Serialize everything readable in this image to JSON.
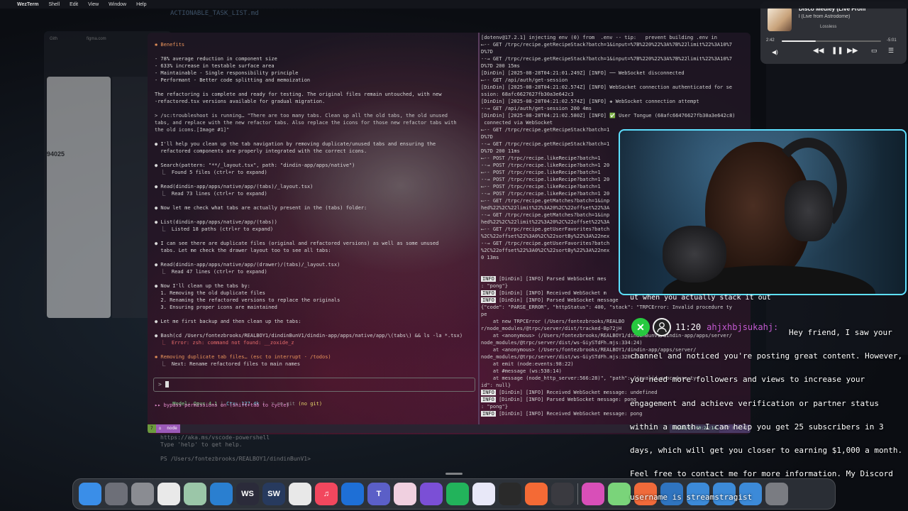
{
  "menubar": {
    "apple": "",
    "app_name": "WezTerm",
    "items": [
      "Shell",
      "Edit",
      "View",
      "Window",
      "Help"
    ]
  },
  "background": {
    "browser_tabs": [
      "Gith",
      "figma.com"
    ],
    "browser_number": "94025",
    "top_text": "ACTIONABLE_TASK_LIST.md",
    "powershell_lines": [
      "https://aka.ms/vscode-powershell",
      "Type 'help' to get help.",
      "",
      "PS /Users/fontezbrooks/REALBOY1/dindinBunV1>"
    ]
  },
  "terminal": {
    "left_lines": [
      {
        "t": "✱ Benefits",
        "c": "orange"
      },
      {
        "t": "",
        "c": ""
      },
      {
        "t": "- 78% average reduction in component size",
        "c": ""
      },
      {
        "t": "- 633% increase in testable surface area",
        "c": ""
      },
      {
        "t": "- Maintainable - Single responsibility principle",
        "c": ""
      },
      {
        "t": "- Performant - Better code splitting and memoization",
        "c": ""
      },
      {
        "t": "",
        "c": ""
      },
      {
        "t": "The refactoring is complete and ready for testing. The original files remain untouched, with new",
        "c": ""
      },
      {
        "t": "-refactored.tsx versions available for gradual migration.",
        "c": ""
      },
      {
        "t": "",
        "c": ""
      },
      {
        "t": "> /sc:troubleshoot is running… \"There are too many tabs. Clean up all the old tabs, the old unused",
        "c": "dim"
      },
      {
        "t": "tabs, and replace with the new refactor tabs. Also replace the icons for those new refactor tabs with",
        "c": "dim"
      },
      {
        "t": "the old icons.[Image #1]\"",
        "c": "dim"
      },
      {
        "t": "",
        "c": ""
      },
      {
        "t": "● I'll help you clean up the tab navigation by removing duplicate/unused tabs and ensuring the",
        "c": "w"
      },
      {
        "t": "  refactored components are properly integrated with the correct icons.",
        "c": ""
      },
      {
        "t": "",
        "c": ""
      },
      {
        "t": "● Search(pattern: \"**/_layout.tsx\", path: \"dindin-app/apps/native\")",
        "c": "g"
      },
      {
        "t": "  ⎿  Found 5 files (ctrl+r to expand)",
        "c": ""
      },
      {
        "t": "",
        "c": ""
      },
      {
        "t": "● Read(dindin-app/apps/native/app/(tabs)/_layout.tsx)",
        "c": "g"
      },
      {
        "t": "  ⎿  Read 73 lines (ctrl+r to expand)",
        "c": ""
      },
      {
        "t": "",
        "c": ""
      },
      {
        "t": "● Now let me check what tabs are actually present in the (tabs) folder:",
        "c": "w"
      },
      {
        "t": "",
        "c": ""
      },
      {
        "t": "● List(dindin-app/apps/native/app/(tabs))",
        "c": "g"
      },
      {
        "t": "  ⎿  Listed 18 paths (ctrl+r to expand)",
        "c": ""
      },
      {
        "t": "",
        "c": ""
      },
      {
        "t": "● I can see there are duplicate files (original and refactored versions) as well as some unused",
        "c": "w"
      },
      {
        "t": "  tabs. Let me check the drawer layout too to see all tabs:",
        "c": ""
      },
      {
        "t": "",
        "c": ""
      },
      {
        "t": "● Read(dindin-app/apps/native/app/(drawer)/(tabs)/_layout.tsx)",
        "c": "g"
      },
      {
        "t": "  ⎿  Read 47 lines (ctrl+r to expand)",
        "c": ""
      },
      {
        "t": "",
        "c": ""
      },
      {
        "t": "● Now I'll clean up the tabs by:",
        "c": "w"
      },
      {
        "t": "  1. Removing the old duplicate files",
        "c": ""
      },
      {
        "t": "  2. Renaming the refactored versions to replace the originals",
        "c": ""
      },
      {
        "t": "  3. Ensuring proper icons are maintained",
        "c": ""
      },
      {
        "t": "",
        "c": ""
      },
      {
        "t": "● Let me first backup and then clean up the tabs:",
        "c": "w"
      },
      {
        "t": "",
        "c": ""
      },
      {
        "t": "● Bash(cd /Users/fontezbrooks/REALBOY1/dindinBunV1/dindin-app/apps/native/app/\\(tabs\\) && ls -la *.tsx)",
        "c": "g"
      },
      {
        "t": "  ⎿  Error: zsh: command not found: __zoxide_z",
        "c": "red"
      },
      {
        "t": "",
        "c": ""
      },
      {
        "t": "✱ Removing duplicate tab files… (esc to interrupt · /todos)",
        "c": "orange"
      },
      {
        "t": "  ⎿  Next: Rename refactored files to main names",
        "c": ""
      }
    ],
    "prompt_symbol": ">",
    "model_line": {
      "model": "Model: Opus 4.1",
      "ctx": "Ctx: 127.4k",
      "git": "(no git)",
      "sep1": " | ",
      "sep2": " | ",
      "nogit_sym": " ⌥ no git "
    },
    "bypass_line": "▸▸ bypass permissions on (shift+tab to cycle)",
    "right_lines": [
      {
        "t": "[dotenv@17.2.1] injecting env (0) from  .env -- tip:   prevent building .env in",
        "c": ""
      },
      {
        "t": "⟵-- GET /trpc/recipe.getRecipeStack?batch=1&input=%7B%220%22%3A%7B%22limit%22%3A10%7",
        "c": ""
      },
      {
        "t": "D%7D",
        "c": ""
      },
      {
        "t": "--→ GET /trpc/recipe.getRecipeStack?batch=1&input=%7B%220%22%3A%7B%22limit%22%3A10%7",
        "c": ""
      },
      {
        "t": "D%7D 200 15ms",
        "c": ""
      },
      {
        "t": "[DinDin] [2025-08-28T04:21:01.249Z] [INFO] ── WebSocket disconnected",
        "c": ""
      },
      {
        "t": "⟵-- GET /api/auth/get-session",
        "c": ""
      },
      {
        "t": "[DinDin] [2025-08-28T04:21:02.574Z] [INFO] WebSocket connection authenticated for se",
        "c": ""
      },
      {
        "t": "ssion: 68afc6627627fb30a3e642c3",
        "c": ""
      },
      {
        "t": "[DinDin] [2025-08-28T04:21:02.574Z] [INFO] ✚ WebSocket connection attempt",
        "c": ""
      },
      {
        "t": "--→ GET /api/auth/get-session 200 4ms",
        "c": ""
      },
      {
        "t": "[DinDin] [2025-08-28T04:21:02.580Z] [INFO] ✅ User Tongue (68afc66476627fb30a3e642c8)",
        "c": ""
      },
      {
        "t": " connected via WebSocket",
        "c": ""
      },
      {
        "t": "⟵-- GET /trpc/recipe.getRecipeStack?batch=1",
        "c": ""
      },
      {
        "t": "D%7D",
        "c": ""
      },
      {
        "t": "--→ GET /trpc/recipe.getRecipeStack?batch=1",
        "c": ""
      },
      {
        "t": "D%7D 200 11ms",
        "c": ""
      },
      {
        "t": "⟵-- POST /trpc/recipe.likeRecipe?batch=1",
        "c": ""
      },
      {
        "t": "--→ POST /trpc/recipe.likeRecipe?batch=1 20",
        "c": ""
      },
      {
        "t": "⟵-- POST /trpc/recipe.likeRecipe?batch=1",
        "c": ""
      },
      {
        "t": "--→ POST /trpc/recipe.likeRecipe?batch=1 20",
        "c": ""
      },
      {
        "t": "⟵-- POST /trpc/recipe.likeRecipe?batch=1",
        "c": ""
      },
      {
        "t": "--→ POST /trpc/recipe.likeRecipe?batch=1 20",
        "c": ""
      },
      {
        "t": "⟵-- GET /trpc/recipe.getMatches?batch=1&inp",
        "c": ""
      },
      {
        "t": "hed%22%2C%22limit%22%3A20%2C%22offset%22%3A",
        "c": ""
      },
      {
        "t": "--→ GET /trpc/recipe.getMatches?batch=1&inp",
        "c": ""
      },
      {
        "t": "hed%22%2C%22limit%22%3A20%2C%22offset%22%3A",
        "c": ""
      },
      {
        "t": "⟵-- GET /trpc/recipe.getUserFavorites?batch",
        "c": ""
      },
      {
        "t": "%2C%22offset%22%3A0%2C%22sortBy%22%3A%22nex",
        "c": ""
      },
      {
        "t": "--→ GET /trpc/recipe.getUserFavorites?batch",
        "c": ""
      },
      {
        "t": "%2C%22offset%22%3A0%2C%22sortBy%22%3A%22nex",
        "c": ""
      },
      {
        "t": "0 13ms",
        "c": ""
      },
      {
        "t": "",
        "c": ""
      },
      {
        "t": "",
        "c": ""
      },
      {
        "t": "INFO [DinDin] [INFO] Parsed WebSocket mes",
        "c": "info"
      },
      {
        "t": ": \"pong\"}",
        "c": ""
      },
      {
        "t": "INFO [DinDin] [INFO] Received WebSocket m",
        "c": "info"
      },
      {
        "t": "INFO [DinDin] [INFO] Parsed WebSocket message",
        "c": "info"
      },
      {
        "t": "{\"code\": \"PARSE_ERROR\", \"httpStatus\": 400, \"stack\": \"TRPCError: Invalid procedure ty",
        "c": ""
      },
      {
        "t": "pe",
        "c": ""
      },
      {
        "t": "    at new TRPCError (/Users/fontezbrooks/REALBO",
        "c": ""
      },
      {
        "t": "r/node_modules/@trpc/server/dist/tracked-Bp72jH",
        "c": ""
      },
      {
        "t": "    at <anonymous> (/Users/fontezbrooks/REALBOY1/dindinBunV1/dindin-app/apps/server/",
        "c": ""
      },
      {
        "t": "node_modules/@trpc/server/dist/ws-GiySTdFh.mjs:334:24)",
        "c": ""
      },
      {
        "t": "    at <anonymous> (/Users/fontezbrooks/REALBOY1/dindin-app/apps/server/",
        "c": ""
      },
      {
        "t": "node_modules/@trpc/server/dist/ws-GiySTdFh.mjs:328:23)",
        "c": ""
      },
      {
        "t": "    at emit (node:events:98:22)",
        "c": ""
      },
      {
        "t": "    at #message (ws:538:14)",
        "c": ""
      },
      {
        "t": "    at message (node_http_server:566:28)\", \"path\": \"invalid-procedure-ty",
        "c": ""
      },
      {
        "t": "id\": null}",
        "c": ""
      },
      {
        "t": "INFO [DinDin] [INFO] Received WebSocket message: undefined",
        "c": "info"
      },
      {
        "t": "INFO [DinDin] [INFO] Parsed WebSocket message: pong",
        "c": "info"
      },
      {
        "t": ": \"pong\"}",
        "c": ""
      },
      {
        "t": "INFO [DinDin] [INFO] Received WebSocket message: pong",
        "c": "info"
      }
    ],
    "status": {
      "tab_num": "7",
      "tab_icon": "⌂",
      "tab_name": "node",
      "datetime": "08/28/25 00:24:14",
      "extra": "+77 F 4:47"
    }
  },
  "music": {
    "title": "Disco Medley (Live From",
    "subtitle": "l (Live from Astrodome)",
    "device": "Lossless",
    "elapsed": "2:42",
    "remaining": "-5:01",
    "progress": 0.34,
    "icons": [
      "speaker-icon",
      "rewind-icon",
      "pause-icon",
      "forward-icon",
      "lyrics-icon",
      "queue-icon"
    ]
  },
  "chat": {
    "header": "ut when you actually stack it out",
    "time": "11:20",
    "user": "ahjxhbjsukahj:",
    "message": "Hey friend, I saw your channel and noticed you're posting great content. However, you need more followers and views to increase your engagement and achieve verification or partner status within a month. I can help you get 25 subscribers in 3 days, which will get you closer to earning $1,000 a month. Feel free to contact me for more information. My Discord username is streamstragist"
  },
  "dock": {
    "apps": [
      {
        "name": "finder-icon",
        "label": "",
        "bg": "#3a8ee8"
      },
      {
        "name": "launchpad-icon",
        "label": "",
        "bg": "#6d6f78"
      },
      {
        "name": "system-settings-icon",
        "label": "",
        "bg": "#8a8c92"
      },
      {
        "name": "chrome-icon",
        "label": "",
        "bg": "#e9e9e9"
      },
      {
        "name": "notes-app-icon",
        "label": "",
        "bg": "#9bc6a8"
      },
      {
        "name": "vscode-icon",
        "label": "",
        "bg": "#2a7fd0"
      },
      {
        "name": "wezterm-icon",
        "label": "WS",
        "bg": "#2b2b3a"
      },
      {
        "name": "sw-icon",
        "label": "SW",
        "bg": "#273a5e"
      },
      {
        "name": "slack-icon",
        "label": "",
        "bg": "#e8e8e8"
      },
      {
        "name": "music-icon",
        "label": "♫",
        "bg": "#f2475e"
      },
      {
        "name": "teamviewer-icon",
        "label": "",
        "bg": "#1e6fd6"
      },
      {
        "name": "teams-icon",
        "label": "T",
        "bg": "#5b5fc7"
      },
      {
        "name": "photos-icon",
        "label": "",
        "bg": "#f0d0e0"
      },
      {
        "name": "obsidian-icon",
        "label": "",
        "bg": "#7b4fd6"
      },
      {
        "name": "git-icon",
        "label": "",
        "bg": "#22b35b"
      },
      {
        "name": "circle-app-icon",
        "label": "",
        "bg": "#e8e8f8"
      },
      {
        "name": "audio-levels-icon",
        "label": "",
        "bg": "#2a2a2a"
      },
      {
        "name": "postman-icon",
        "label": "",
        "bg": "#f46a35"
      },
      {
        "name": "grid-app-icon",
        "label": "",
        "bg": "#3a3a40"
      },
      {
        "name": "stickies-icon",
        "label": "",
        "bg": "#d84fb8"
      },
      {
        "name": "star-app-icon",
        "label": "",
        "bg": "#7ad47a"
      },
      {
        "name": "bolt-app-icon",
        "label": "",
        "bg": "#f06a3a"
      },
      {
        "name": "blue-app-icon",
        "label": "",
        "bg": "#2f74c0"
      },
      {
        "name": "folder-a-icon",
        "label": "",
        "bg": "#3c8ad8"
      },
      {
        "name": "folder-b-icon",
        "label": "",
        "bg": "#3c8ad8"
      },
      {
        "name": "folder-c-icon",
        "label": "",
        "bg": "#3c8ad8"
      },
      {
        "name": "trash-icon",
        "label": "",
        "bg": "#7a7c82"
      }
    ]
  },
  "colors": {
    "webcam_border": "#5ee0ff",
    "chat_username": "#c45ad1",
    "mod_badge": "#27c93f",
    "status_green": "#6c9a3e",
    "status_purple": "#9b5ab8"
  }
}
